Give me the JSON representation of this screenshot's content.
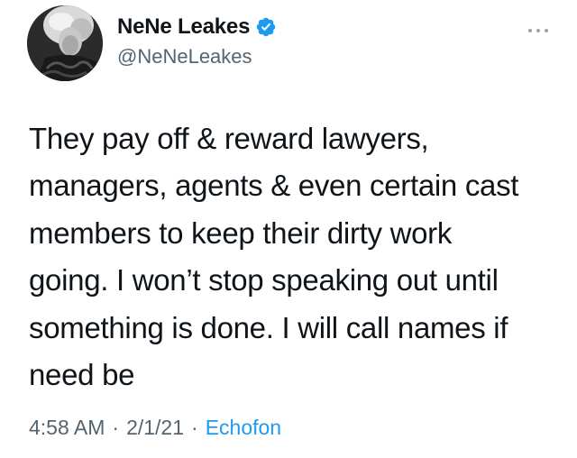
{
  "user": {
    "display_name": "NeNe Leakes",
    "handle": "@NeNeLeakes",
    "verified": true,
    "verified_color": "#1d9bf0"
  },
  "tweet": {
    "text": "They pay off & reward  lawyers,\nmanagers, agents & even certain cast\nmembers to keep their dirty work\ngoing. I won’t stop speaking out until\nsomething is done. I will call names if\nneed be",
    "time": "4:58 AM",
    "date": "2/1/21",
    "separator": "·",
    "source": "Echofon"
  },
  "icons": {
    "avatar": "profile-photo",
    "verified": "verified-badge-icon",
    "more": "more-options-icon"
  },
  "colors": {
    "text": "#0f1419",
    "secondary": "#536471",
    "link": "#1d9bf0",
    "background": "#ffffff"
  }
}
